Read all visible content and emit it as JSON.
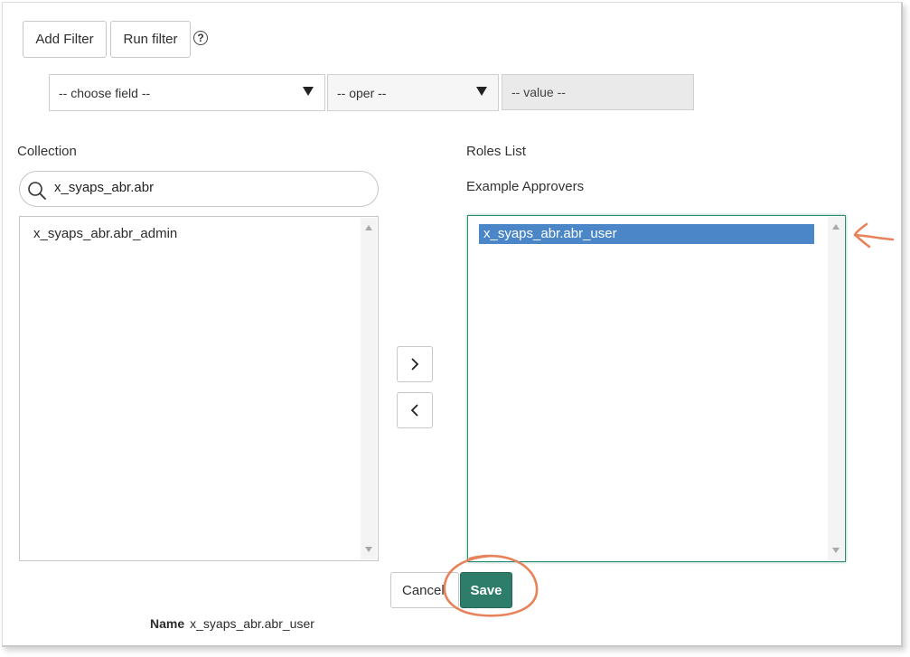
{
  "toolbar": {
    "add_filter_label": "Add Filter",
    "run_filter_label": "Run filter",
    "help_glyph": "?"
  },
  "filter": {
    "field_select": "-- choose field --",
    "oper_select": "-- oper --",
    "value_field": "-- value --"
  },
  "collection": {
    "label": "Collection",
    "search_value": "x_syaps_abr.abr",
    "items": [
      "x_syaps_abr.abr_admin"
    ]
  },
  "roles": {
    "label": "Roles List",
    "sublabel": "Example Approvers",
    "items": [
      "x_syaps_abr.abr_user"
    ]
  },
  "actions": {
    "add_glyph": "›",
    "remove_glyph": "‹",
    "cancel_label": "Cancel",
    "save_label": "Save"
  },
  "name_field": {
    "label": "Name",
    "value": "x_syaps_abr.abr_user"
  },
  "colors": {
    "selected": "#4a86c8",
    "save": "#2e7d6b",
    "annotation": "#e8825a",
    "focus_border": "#2e8b73"
  },
  "icons": [
    "help-icon",
    "search-icon",
    "chevron-right-icon",
    "chevron-left-icon",
    "caret-down-icon"
  ]
}
